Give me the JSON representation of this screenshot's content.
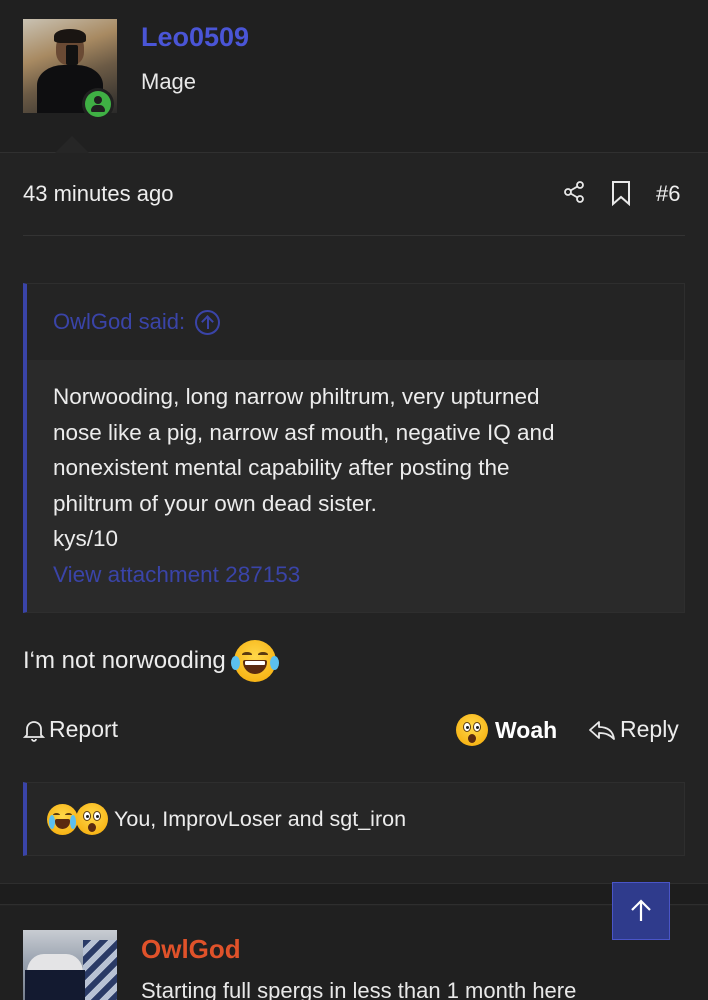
{
  "post": {
    "username": "Leo0509",
    "user_title": "Mage",
    "timestamp": "43 minutes ago",
    "post_number": "#6",
    "quote": {
      "author": "OwlGod said:",
      "lines": [
        "Norwooding, long narrow philtrum, very upturned",
        "nose like a pig, narrow asf mouth, negative IQ and",
        "nonexistent mental capability after posting the",
        "philtrum of your own dead sister.",
        "kys/10"
      ],
      "attachment_link": "View attachment 287153"
    },
    "message": "I‘m not norwooding",
    "actions": {
      "report": "Report",
      "reaction": "Woah",
      "reply": "Reply"
    },
    "reactions_summary": "You, ImprovLoser and sgt_iron"
  },
  "next_post": {
    "username": "OwlGod",
    "snippet": "Starting full spergs in less than 1 month here"
  },
  "colors": {
    "accent": "#3a44a8",
    "username_primary": "#4a55d6",
    "username_secondary": "#e0522a",
    "online": "#3fb044",
    "background": "#232323"
  },
  "icons": {
    "online_status": "user-online-icon",
    "share": "share-icon",
    "bookmark": "bookmark-icon",
    "quote_jump": "arrow-up-circle-icon",
    "report": "bell-icon",
    "reply": "reply-arrow-icon",
    "scroll_top": "arrow-up-icon"
  }
}
